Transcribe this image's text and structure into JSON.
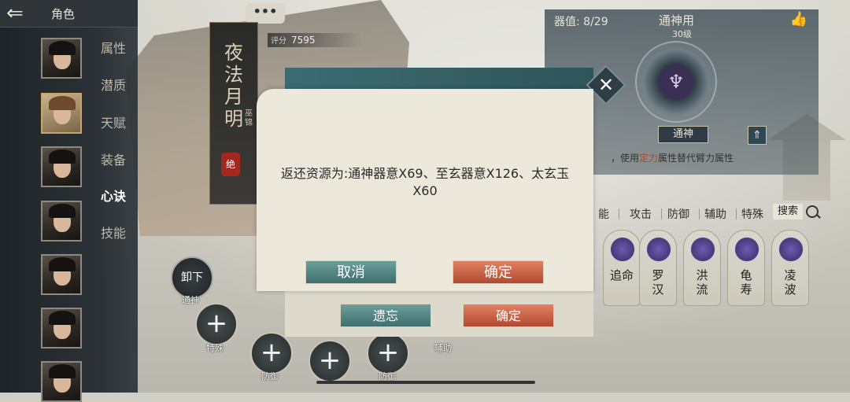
{
  "header": {
    "back_icon": "back-arrow-icon",
    "title": "角色"
  },
  "sidebar": {
    "menu": [
      "属性",
      "潜质",
      "天赋",
      "装备",
      "心诀",
      "技能"
    ],
    "active_index": 4
  },
  "chat": {
    "label": "•••"
  },
  "banner": {
    "name": "夜法月明",
    "subtitle": "巫锦",
    "seal": "绝"
  },
  "score": {
    "label": "评分",
    "value": "7595"
  },
  "equip_panel": {
    "qizhi": "器值: 8/29",
    "title": "通神用",
    "level": "30级",
    "badge": "通神",
    "description_prefix": "，使用",
    "description_highlight": "定力",
    "description_suffix": "属性替代臂力属性"
  },
  "tabs": [
    "能",
    "攻击",
    "防御",
    "辅助",
    "特殊"
  ],
  "search": {
    "label": "搜索"
  },
  "skill_cards": [
    "追命",
    "罗汉",
    "洪流",
    "龟寿",
    "凌波"
  ],
  "dialog": {
    "message": "返还资源为:通神器意X69、至玄器意X126、太玄玉X60",
    "cancel": "取消",
    "confirm": "确定"
  },
  "under_dialog": {
    "forget": "遗忘",
    "confirm": "确定"
  },
  "slots": {
    "unload": "卸下",
    "tongshen": "通神",
    "special": "特殊",
    "defense1": "防御",
    "defense2": "防御",
    "assist": "辅助"
  },
  "colors": {
    "teal": "#3f6e6c",
    "red": "#b0492f",
    "highlight": "#b0471d"
  }
}
